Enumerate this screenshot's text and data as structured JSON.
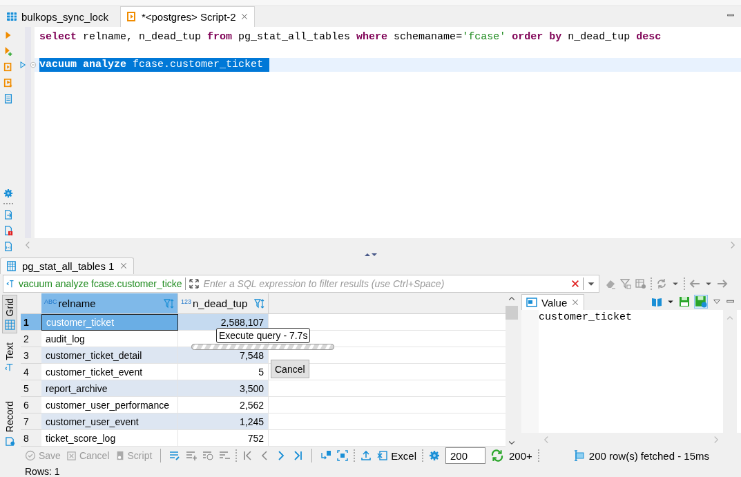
{
  "editor_tabs": [
    {
      "label": "bulkops_sync_lock",
      "selected": false,
      "closable": false
    },
    {
      "label": "*<postgres> Script-2",
      "selected": true,
      "closable": true
    }
  ],
  "editor": {
    "lines": [
      {
        "kind": "code",
        "selected": false,
        "tokens": [
          {
            "text": "select",
            "kind": "keyword"
          },
          {
            "text": " relname, n_dead_tup ",
            "kind": "plain"
          },
          {
            "text": "from",
            "kind": "keyword"
          },
          {
            "text": " pg_stat_all_tables ",
            "kind": "plain"
          },
          {
            "text": "where",
            "kind": "keyword"
          },
          {
            "text": " schemaname=",
            "kind": "plain"
          },
          {
            "text": "'fcase'",
            "kind": "string"
          },
          {
            "text": " order by",
            "kind": "keyword"
          },
          {
            "text": " n_dead_tup ",
            "kind": "plain"
          },
          {
            "text": "desc",
            "kind": "keyword"
          }
        ]
      },
      {
        "kind": "blank"
      },
      {
        "kind": "code",
        "selected": true,
        "tokens": [
          {
            "text": "vacuum analyze",
            "kind": "keyword"
          },
          {
            "text": " fcase.customer_ticket ",
            "kind": "plain"
          }
        ]
      }
    ]
  },
  "results_tab": {
    "label": "pg_stat_all_tables 1",
    "selected": true
  },
  "filter": {
    "query": "vacuum analyze fcase.customer_ticke",
    "placeholder": "Enter a SQL expression to filter results (use Ctrl+Space)"
  },
  "view_tabs": [
    {
      "label": "Grid",
      "selected": true
    },
    {
      "label": "Text",
      "selected": false
    },
    {
      "label": "Record",
      "selected": false
    }
  ],
  "grid": {
    "columns": [
      {
        "label": "relname",
        "type": "ABC",
        "selected": true
      },
      {
        "label": "n_dead_tup",
        "type": "123",
        "selected": false
      }
    ],
    "rows": [
      {
        "number": "1",
        "relname": "customer_ticket",
        "n_dead_tup": "2,588,107",
        "selected": true
      },
      {
        "number": "2",
        "relname": "audit_log",
        "selected": false
      },
      {
        "number": "3",
        "relname": "customer_ticket_detail",
        "n_dead_tup": "7,548",
        "selected": false
      },
      {
        "number": "4",
        "relname": "customer_ticket_event",
        "n_dead_tup": "5",
        "selected": false
      },
      {
        "number": "5",
        "relname": "report_archive",
        "n_dead_tup": "3,500",
        "selected": false
      },
      {
        "number": "6",
        "relname": "customer_user_performance",
        "n_dead_tup": "2,562",
        "selected": false
      },
      {
        "number": "7",
        "relname": "customer_user_event",
        "n_dead_tup": "1,245",
        "selected": false
      },
      {
        "number": "8",
        "relname": "ticket_score_log",
        "n_dead_tup": "752",
        "selected": false
      }
    ]
  },
  "progress": {
    "label": "Execute query - 7.7s",
    "level": 1,
    "cancel": "Cancel"
  },
  "value_panel": {
    "title": "Value",
    "value": "customer_ticket"
  },
  "toolbar": {
    "buttons": [
      {
        "label": "Save",
        "disabled": true
      },
      {
        "label": "Cancel",
        "disabled": true
      },
      {
        "label": "Script",
        "disabled": true
      }
    ],
    "export": "Excel",
    "fetch_size": "200",
    "fetch_more": "200+",
    "status": "200 row(s) fetched - 15ms"
  },
  "footer": "Rows: 1"
}
